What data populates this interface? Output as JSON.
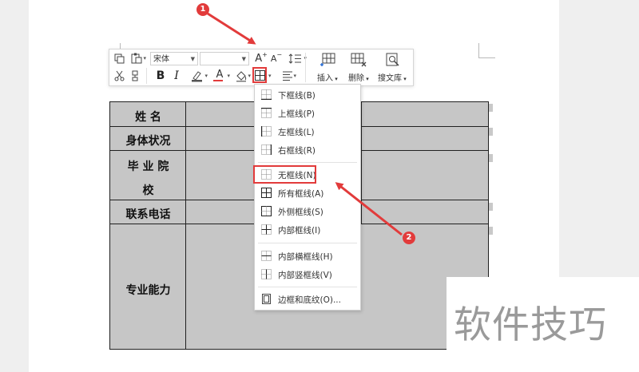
{
  "toolbar": {
    "font_name": "宋体",
    "font_size": "",
    "insert_label": "插入",
    "delete_label": "删除",
    "search_label": "搜文库",
    "bold_label": "B",
    "italic_label": "I",
    "grow_label": "A",
    "shrink_label": "A",
    "font_color_label": "A"
  },
  "table": {
    "labels": [
      "姓  名",
      "身体状况",
      "毕 业 院",
      "校",
      "联系电话",
      "专业能力"
    ]
  },
  "dropdown": {
    "items": [
      {
        "label": "下框线(B)",
        "icon": "bottom-border-icon"
      },
      {
        "label": "上框线(P)",
        "icon": "top-border-icon"
      },
      {
        "label": "左框线(L)",
        "icon": "left-border-icon"
      },
      {
        "label": "右框线(R)",
        "icon": "right-border-icon"
      },
      {
        "label": "无框线(N)",
        "icon": "no-border-icon"
      },
      {
        "label": "所有框线(A)",
        "icon": "all-borders-icon"
      },
      {
        "label": "外侧框线(S)",
        "icon": "outside-borders-icon"
      },
      {
        "label": "内部框线(I)",
        "icon": "inside-borders-icon"
      },
      {
        "label": "内部横框线(H)",
        "icon": "inside-horizontal-border-icon"
      },
      {
        "label": "内部竖框线(V)",
        "icon": "inside-vertical-border-icon"
      },
      {
        "label": "边框和底纹(O)...",
        "icon": "borders-shading-icon"
      }
    ]
  },
  "annotations": {
    "step1": "1",
    "step2": "2"
  },
  "watermark": "软件技巧",
  "colors": {
    "accent_red": "#e23b3b",
    "table_fill": "#c6c6c6"
  }
}
